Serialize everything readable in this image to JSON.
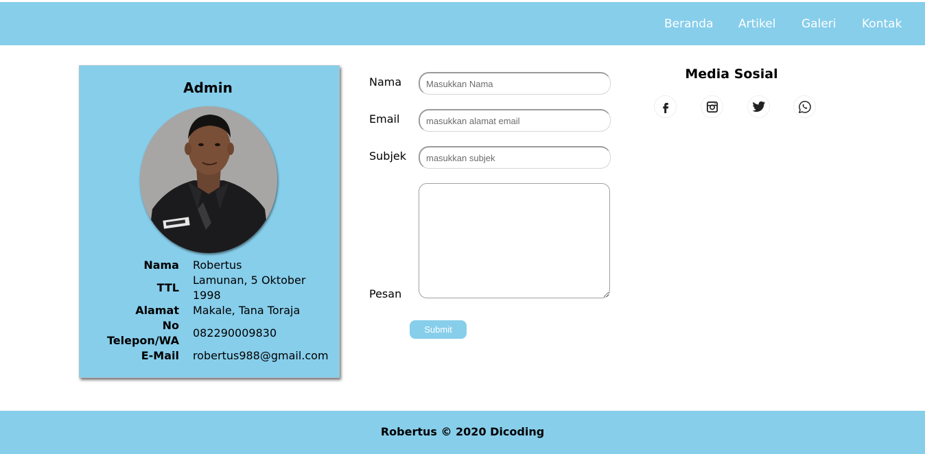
{
  "nav": {
    "items": [
      "Beranda",
      "Artikel",
      "Galeri",
      "Kontak"
    ]
  },
  "profile": {
    "title": "Admin",
    "photo": "profile-photo",
    "rows": [
      {
        "key": "Nama",
        "value": "Robertus"
      },
      {
        "key": "TTL",
        "value": "Lamunan, 5 Oktober 1998"
      },
      {
        "key": "Alamat",
        "value": "Makale, Tana Toraja"
      },
      {
        "key": "No Telepon/WA",
        "value": "082290009830"
      },
      {
        "key": "E-Mail",
        "value": "robertus988@gmail.com"
      }
    ]
  },
  "form": {
    "nama_label": "Nama",
    "nama_placeholder": "Masukkan Nama",
    "email_label": "Email",
    "email_placeholder": "masukkan alamat email",
    "subjek_label": "Subjek",
    "subjek_placeholder": "masukkan subjek",
    "pesan_label": "Pesan",
    "submit_label": "Submit"
  },
  "social": {
    "title": "Media Sosial",
    "icons": [
      "facebook-icon",
      "instagram-icon",
      "twitter-icon",
      "whatsapp-icon"
    ]
  },
  "footer": {
    "text": "Robertus © 2020 Dicoding"
  },
  "colors": {
    "accent": "#87ceeb",
    "nav_text": "#ffffff"
  }
}
